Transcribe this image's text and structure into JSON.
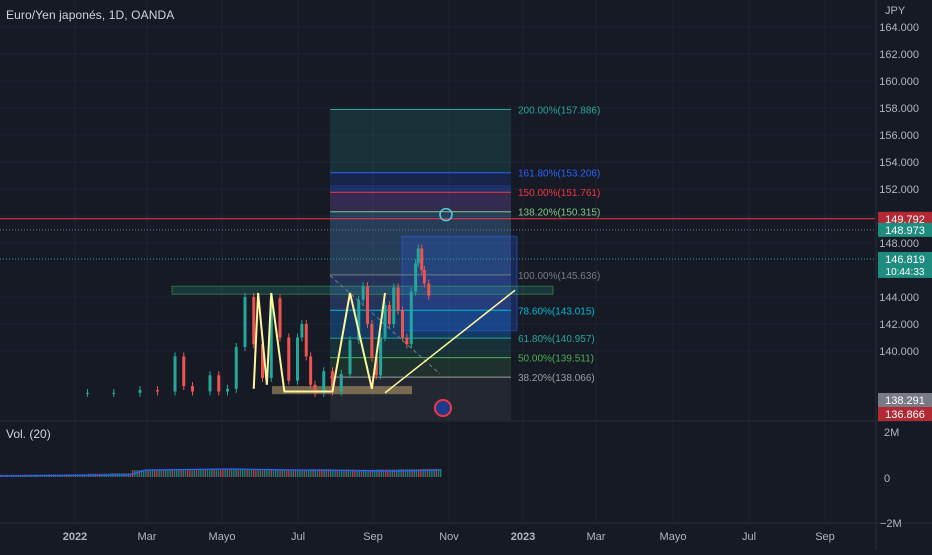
{
  "header": {
    "symbol_title": "Euro/Yen japonés, 1D, OANDA",
    "currency": "JPY"
  },
  "volume_panel": {
    "title": "Vol. (20)",
    "ticks": [
      "2M",
      "0",
      "−2M"
    ]
  },
  "price_axis": {
    "ticks": [
      "164.000",
      "162.000",
      "160.000",
      "158.000",
      "156.000",
      "154.000",
      "152.000",
      "150.000",
      "148.000",
      "144.000",
      "142.000",
      "140.000"
    ]
  },
  "time_axis": {
    "labels": [
      "2022",
      "Mar",
      "Mayo",
      "Jul",
      "Sep",
      "Nov",
      "2023",
      "Mar",
      "Mayo",
      "Jul",
      "Sep"
    ]
  },
  "price_badges": [
    {
      "label": "149.792",
      "color": "#b22833"
    },
    {
      "label": "148.973",
      "color": "#1e8c7e"
    },
    {
      "label": "146.819",
      "sub": "10:44:33",
      "color": "#1e8c7e"
    },
    {
      "label": "138.291",
      "color": "#787b86"
    },
    {
      "label": "136.866",
      "color": "#b22833"
    }
  ],
  "fib_levels": [
    {
      "label": "200.00%(157.886)",
      "color": "#26a69a"
    },
    {
      "label": "161.80%(153.206)",
      "color": "#2962ff"
    },
    {
      "label": "150.00%(151.761)",
      "color": "#f23645"
    },
    {
      "label": "138.20%(150.315)",
      "color": "#81c784"
    },
    {
      "label": "100.00%(145.636)",
      "color": "#787b86"
    },
    {
      "label": "78.60%(143.015)",
      "color": "#00bcd4"
    },
    {
      "label": "61.80%(140.957)",
      "color": "#26a69a"
    },
    {
      "label": "50.00%(139.511)",
      "color": "#4caf50"
    },
    {
      "label": "38.20%(138.066)",
      "color": "#9e9e9e"
    }
  ],
  "colors": {
    "background": "#161a25",
    "candle_up": "#26a69a",
    "candle_down": "#ef5350",
    "pattern_line": "#fff59d",
    "resistance_line": "#f23645",
    "volume_line": "#2962ff"
  },
  "chart_data": {
    "type": "candlestick",
    "title": "Euro/Yen japonés, 1D, OANDA",
    "ylabel": "JPY",
    "ylim": [
      136.5,
      165.0
    ],
    "price_ticks": [
      164,
      162,
      160,
      158,
      156,
      154,
      152,
      150,
      148,
      144,
      142,
      140
    ],
    "x_labels": [
      "2022",
      "Mar",
      "Mayo",
      "Jul",
      "Sep",
      "Nov",
      "2023",
      "Mar",
      "Mayo",
      "Jul",
      "Sep"
    ],
    "series": [
      {
        "name": "candles",
        "path": [
          [
            0.1,
            136.9
          ],
          [
            0.13,
            136.9
          ],
          [
            0.16,
            137.1
          ],
          [
            0.18,
            137.0
          ],
          [
            0.2,
            139.6
          ],
          [
            0.21,
            137.4
          ],
          [
            0.22,
            137.0
          ],
          [
            0.24,
            138.2
          ],
          [
            0.25,
            137.0
          ],
          [
            0.26,
            137.2
          ],
          [
            0.27,
            140.3
          ],
          [
            0.28,
            144.0
          ],
          [
            0.29,
            140.5
          ],
          [
            0.3,
            138.0
          ],
          [
            0.31,
            143.9
          ],
          [
            0.32,
            141.0
          ],
          [
            0.33,
            137.8
          ],
          [
            0.34,
            141.0
          ],
          [
            0.345,
            142.0
          ],
          [
            0.35,
            139.6
          ],
          [
            0.355,
            137.5
          ],
          [
            0.36,
            136.9
          ],
          [
            0.37,
            138.5
          ],
          [
            0.38,
            137.0
          ],
          [
            0.39,
            138.3
          ],
          [
            0.4,
            140.8
          ],
          [
            0.41,
            143.8
          ],
          [
            0.415,
            144.8
          ],
          [
            0.42,
            142.0
          ],
          [
            0.425,
            139.5
          ],
          [
            0.43,
            138.2
          ],
          [
            0.435,
            141.0
          ],
          [
            0.44,
            143.4
          ],
          [
            0.445,
            142.0
          ],
          [
            0.45,
            144.7
          ],
          [
            0.455,
            143.0
          ],
          [
            0.46,
            141.0
          ],
          [
            0.465,
            140.5
          ],
          [
            0.47,
            144.4
          ],
          [
            0.475,
            146.5
          ],
          [
            0.478,
            147.6
          ],
          [
            0.482,
            146.0
          ],
          [
            0.485,
            145.0
          ],
          [
            0.49,
            144.1
          ]
        ]
      },
      {
        "name": "volume",
        "ylim": [
          -2000000,
          2000000
        ],
        "values": [
          150000,
          160000,
          170000,
          180000,
          220000,
          250000,
          230000,
          240000,
          260000,
          250000,
          270000,
          240000,
          250000,
          230000,
          260000,
          250000,
          240000,
          250000,
          260000,
          270000
        ]
      }
    ],
    "fib_extension": {
      "levels": [
        200.0,
        161.8,
        150.0,
        138.2,
        100.0,
        78.6,
        61.8,
        50.0,
        38.2
      ],
      "prices": [
        157.886,
        153.206,
        151.761,
        150.315,
        145.636,
        143.015,
        140.957,
        139.511,
        138.066
      ]
    },
    "horizontal_levels": [
      149.792,
      148.973,
      146.819,
      138.291,
      136.866
    ],
    "zones": [
      {
        "from": 144.2,
        "to": 144.8,
        "label": ""
      },
      {
        "from": 136.8,
        "to": 137.4,
        "label": ""
      }
    ],
    "pattern_points": [
      [
        0.29,
        137.2
      ],
      [
        0.295,
        144.3
      ],
      [
        0.305,
        137.5
      ],
      [
        0.31,
        144.3
      ],
      [
        0.325,
        137.0
      ],
      [
        0.38,
        137.0
      ],
      [
        0.4,
        144.3
      ],
      [
        0.425,
        137.2
      ],
      [
        0.44,
        144.3
      ]
    ],
    "trendline": [
      [
        0.44,
        136.9
      ],
      [
        0.6,
        144.5
      ]
    ],
    "grid": true,
    "legend_position": "top-left"
  }
}
